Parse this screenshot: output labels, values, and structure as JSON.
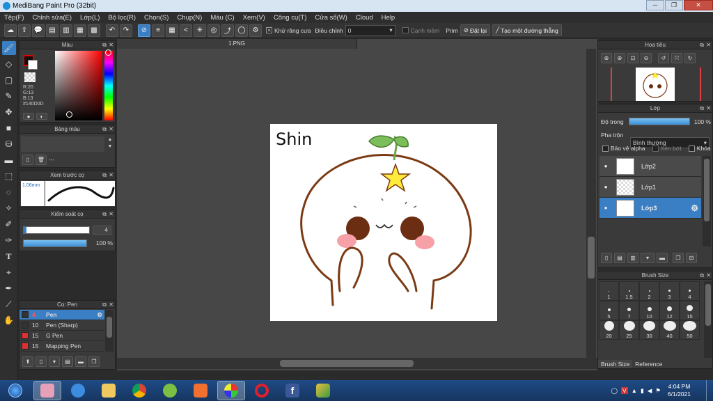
{
  "window": {
    "title": "MediBang Paint Pro (32bit)"
  },
  "menu": [
    "Tệp(F)",
    "Chỉnh sửa(E)",
    "Lớp(L)",
    "Bộ lọc(R)",
    "Chọn(S)",
    "Chụp(N)",
    "Màu (C)",
    "Xem(V)",
    "Công cụ(T)",
    "Cửa sổ(W)",
    "Cloud",
    "Help"
  ],
  "toolbar": {
    "antialias_label": "Khử răng cưa",
    "adjust_label": "Điều chỉnh",
    "adjust_value": "0",
    "edge_label": "Cạnh mềm",
    "prim_label": "Prim",
    "reset_label": "Đặt lại",
    "create_line_label": "Tạo một đường thẳng"
  },
  "color_panel": {
    "title": "Màu",
    "r": "R:20",
    "g": "G:13",
    "b": "B:13",
    "hex": "#140D0D",
    "primary_color": "#140D0D",
    "secondary_color": "#ffffff"
  },
  "palette_panel": {
    "title": "Bảng màu",
    "footer": "---"
  },
  "brush_preview_panel": {
    "title": "Xem trước cọ",
    "size": "1.06mm"
  },
  "brush_control_panel": {
    "title": "Kiểm soát cọ",
    "size_value": "4",
    "opacity_value": "100 %"
  },
  "brush_list_panel": {
    "title": "Cọ: Pen",
    "items": [
      {
        "size": "4",
        "name": "Pen",
        "color": "#333333"
      },
      {
        "size": "10",
        "name": "Pen (Sharp)",
        "color": "#333333"
      },
      {
        "size": "15",
        "name": "G Pen",
        "color": "#e03030"
      },
      {
        "size": "15",
        "name": "Mapping Pen",
        "color": "#e03030"
      }
    ]
  },
  "document": {
    "tab": "1.PNG",
    "canvas_text": "Shin"
  },
  "navigator_panel": {
    "title": "Hoa tiêu"
  },
  "layer_panel": {
    "title": "Lớp",
    "opacity_label": "Độ trong",
    "opacity_value": "100 %",
    "opacity_level": 1.0,
    "blend_label": "Pha trộn",
    "blend_value": "Bình thường",
    "protect_alpha": "Bảo vệ alpha",
    "clipping": "Xén bớt",
    "lock": "Khóa",
    "layers": [
      {
        "name": "Lớp2"
      },
      {
        "name": "Lớp1"
      },
      {
        "name": "Lớp3",
        "selected": true
      }
    ]
  },
  "brush_size_panel": {
    "title": "Brush Size",
    "sizes": [
      "1",
      "1.5",
      "2",
      "3",
      "4",
      "5",
      "7",
      "10",
      "12",
      "15",
      "20",
      "25",
      "30",
      "40",
      "50"
    ],
    "tabs": [
      "Brush Size",
      "Reference"
    ]
  },
  "taskbar": {
    "time": "4:04 PM",
    "date": "6/1/2021"
  }
}
